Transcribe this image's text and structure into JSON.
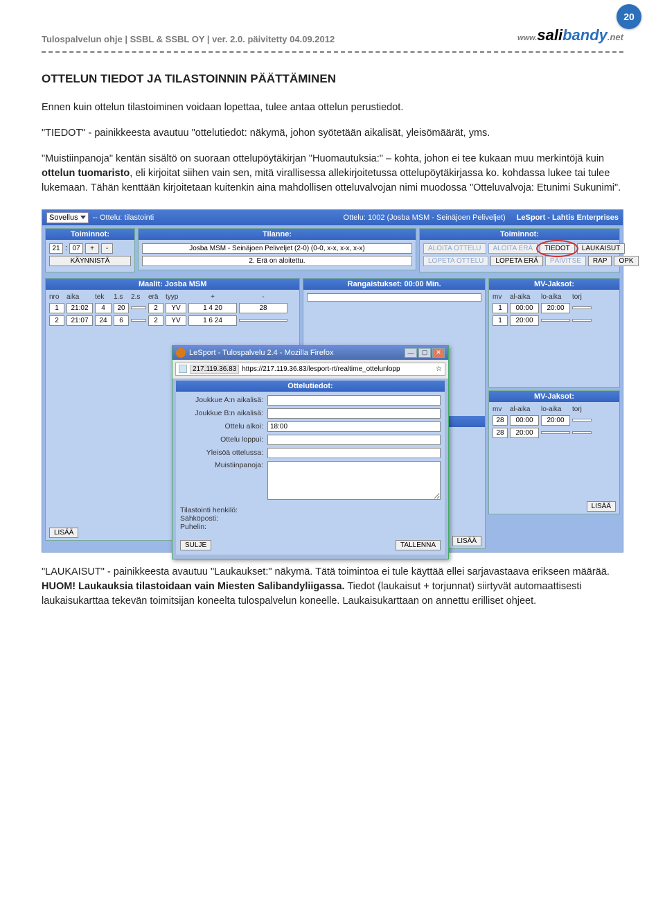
{
  "page_number": "20",
  "header": {
    "breadcrumb": "Tulospalvelun ohje | SSBL & SSBL OY | ver. 2.0. päivitetty 04.09.2012",
    "logo_prefix": "www.",
    "logo_sali": "sali",
    "logo_bandy": "bandy",
    "logo_net": ".net"
  },
  "text": {
    "h2": "OTTELUN TIEDOT JA TILASTOINNIN PÄÄTTÄMINEN",
    "p1": "Ennen kuin ottelun tilastoiminen voidaan lopettaa, tulee antaa ottelun perustiedot.",
    "p2a": "\"TIEDOT\" - painikkeesta avautuu \"ottelutiedot: näkymä, johon syötetään aikalisät, yleisömäärät, yms.",
    "p3a": "\"Muistiinpanoja\" kentän sisältö on suoraan ottelupöytäkirjan \"Huomautuksia:\" – kohta, johon ei tee kukaan muu merkintöjä kuin ",
    "p3b": "ottelun tuomaristo",
    "p3c": ", eli kirjoitat siihen vain sen, mitä virallisessa allekirjoitetussa ottelupöytäkirjassa ko. kohdassa lukee tai tulee lukemaan. Tähän kenttään kirjoitetaan kuitenkin aina mahdollisen otteluvalvojan nimi muodossa \"Otteluvalvoja: Etunimi Sukunimi\".",
    "p4a": "\"LAUKAISUT\" - painikkeesta avautuu \"Laukaukset:\" näkymä. Tätä toimintoa ei tule käyttää ellei sarjavastaava erikseen määrää. ",
    "p4b": "HUOM! Laukauksia tilastoidaan vain Miesten Salibandyliigassa.",
    "p4c": " Tiedot (laukaisut + torjunnat) siirtyvät automaattisesti laukaisukarttaa tekevän toimitsijan koneelta tulospalvelun koneelle. Laukaisukarttaan on annettu erilliset ohjeet."
  },
  "app": {
    "toolbar": {
      "sovellus_lbl": "Sovellus",
      "ottelu_dd": "-- Ottelu: tilastointi",
      "ottelu_lbl": "Ottelu: 1002 (Josba MSM - Seinäjoen Peliveljet)",
      "right_lbl": "LeSport - Lahtis Enterprises"
    },
    "left": {
      "head": "Toiminnot:",
      "time_h": "21",
      "time_m": "07",
      "plus": "+",
      "minus": "-",
      "start_btn": "KÄYNNISTÄ",
      "lisaa": "LISÄÄ"
    },
    "tilanne": {
      "head": "Tilanne:",
      "line1": "Josba MSM - Seinäjoen Peliveljet (2-0) (0-0, x-x, x-x, x-x)",
      "line2": "2. Erä on aloitettu."
    },
    "actions": {
      "head": "Toiminnot:",
      "aloita_ottelu": "ALOITA OTTELU",
      "aloita_era": "ALOITA ERÄ",
      "tiedot": "TIEDOT",
      "laukaisut": "LAUKAISUT",
      "lopeta_ottelu": "LOPETA OTTELU",
      "lopeta_era": "LOPETA ERÄ",
      "paivitse": "PÄIVITSE",
      "rap": "RAP",
      "opk": "OPK"
    },
    "maalit": {
      "head": "Maalit: Josba MSM",
      "hdr": {
        "nro": "nro",
        "aika": "aika",
        "tek": "tek",
        "s1": "1.s",
        "s2": "2.s",
        "era": "erä",
        "tyyp": "tyyp",
        "plus": "+",
        "minus": "-"
      },
      "rows": [
        {
          "nro": "1",
          "aika": "21:02",
          "tek": "4",
          "s1": "20",
          "s2": "",
          "era": "2",
          "tyyp": "YV",
          "plus": "1 4 20",
          "minus": "28"
        },
        {
          "nro": "2",
          "aika": "21:07",
          "tek": "24",
          "s1": "6",
          "s2": "",
          "era": "2",
          "tyyp": "YV",
          "plus": "1 6 24",
          "minus": ""
        }
      ],
      "lisaa": "LISÄÄ"
    },
    "rang": {
      "head": "Rangaistukset: 00:00 Min.",
      "head2": "00:00 Min.",
      "lisaa": "LISÄÄ"
    },
    "mv": {
      "head": "MV-Jaksot:",
      "hdr": {
        "mv": "mv",
        "al": "al-aika",
        "lo": "lo-aika",
        "torj": "torj"
      },
      "rows": [
        {
          "mv": "1",
          "al": "00:00",
          "lo": "20:00",
          "torj": ""
        },
        {
          "mv": "1",
          "al": "20:00",
          "lo": "",
          "torj": ""
        }
      ],
      "rows2": [
        {
          "mv": "28",
          "al": "00:00",
          "lo": "20:00",
          "torj": ""
        },
        {
          "mv": "28",
          "al": "20:00",
          "lo": "",
          "torj": ""
        }
      ],
      "lisaa": "LISÄÄ"
    }
  },
  "modal": {
    "title": "LeSport - Tulospalvelu 2.4 - Mozilla Firefox",
    "url_host": "217.119.36.83",
    "url": "https://217.119.36.83/lesport-rt/realtime_ottelunlopp",
    "panel_head": "Ottelutiedot:",
    "f1": "Joukkue A:n aikalisä:",
    "f2": "Joukkue B:n aikalisä:",
    "f3": "Ottelu alkoi:",
    "f3v": "18:00",
    "f4": "Ottelu loppui:",
    "f5": "Yleisöä ottelussa:",
    "f6": "Muistiinpanoja:",
    "c1": "Tilastointi henkilö:",
    "c2": "Sähköposti:",
    "c3": "Puhelin:",
    "btn_close": "SULJE",
    "btn_save": "TALLENNA"
  }
}
